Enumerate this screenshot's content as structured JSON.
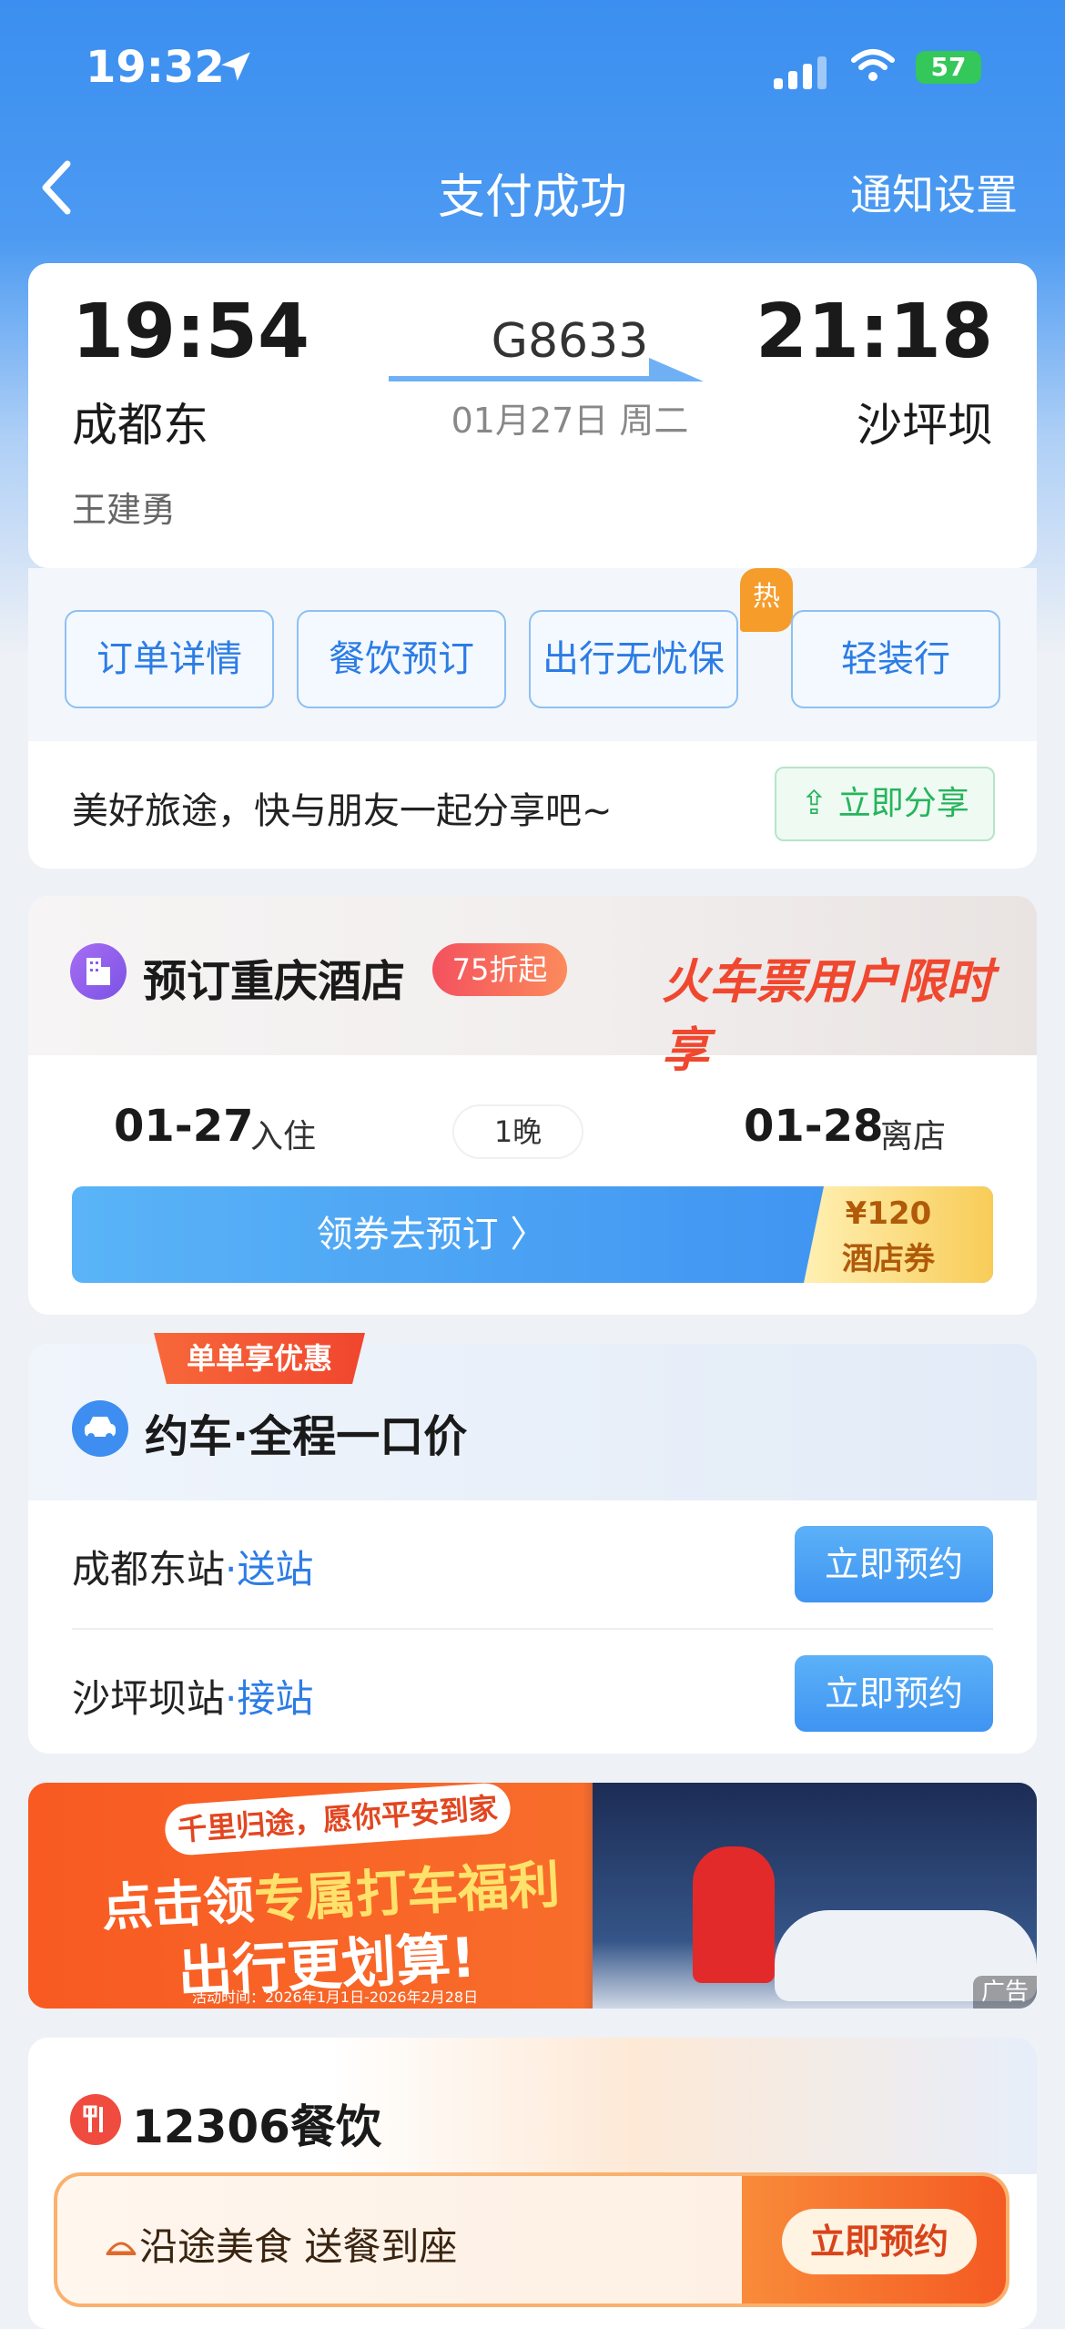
{
  "status_bar": {
    "time": "19:32",
    "battery": "57"
  },
  "nav": {
    "title": "支付成功",
    "right_action": "通知设置"
  },
  "trip": {
    "depart_time": "19:54",
    "depart_station": "成都东",
    "train_no": "G8633",
    "date": "01月27日 周二",
    "arrive_time": "21:18",
    "arrive_station": "沙坪坝",
    "passenger": "王建勇"
  },
  "actions": [
    {
      "label": "订单详情"
    },
    {
      "label": "餐饮预订"
    },
    {
      "label": "出行无忧保",
      "badge": "热"
    },
    {
      "label": "轻装行"
    }
  ],
  "share": {
    "text": "美好旅途，快与朋友一起分享吧~",
    "button": "立即分享"
  },
  "hotel": {
    "title": "预订重庆酒店",
    "discount": "75折起",
    "slogan": "火车票用户限时享",
    "checkin_date": "01-27",
    "checkin_label": "入住",
    "nights": "1晚",
    "checkout_date": "01-28",
    "checkout_label": "离店",
    "coupon_cta": "领券去预订 〉",
    "coupon_amount": "¥120",
    "coupon_name": "酒店券"
  },
  "car": {
    "ribbon": "单单享优惠",
    "title": "约车·全程一口价",
    "rows": [
      {
        "station": "成都东站",
        "service": "·送站",
        "button": "立即预约"
      },
      {
        "station": "沙坪坝站",
        "service": "·接站",
        "button": "立即预约"
      }
    ]
  },
  "ad": {
    "tag": "千里归途，愿你平安到家",
    "line1_a": "点击领",
    "line1_b": "专属打车福利",
    "line2": "出行更划算!",
    "dates": "活动时间：2026年1月1日-2026年2月28日",
    "label": "广告"
  },
  "food": {
    "title": "12306餐饮",
    "tags": "沿途美食  送餐到座",
    "button": "立即预约"
  },
  "colors": {
    "primary": "#3b8ff0",
    "accent_orange": "#f45a22",
    "share_green": "#27b45c"
  }
}
